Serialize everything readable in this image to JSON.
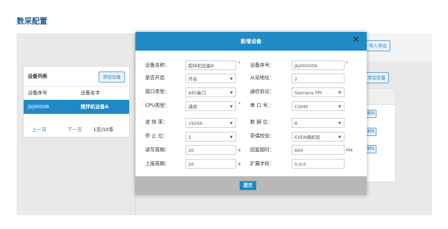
{
  "page": {
    "title": "数采配置"
  },
  "toolbar": {
    "export_label": "导入导出",
    "add_var_label": "添加变量"
  },
  "device_list": {
    "title": "设备列表",
    "add_label": "添加设备",
    "columns": [
      "设备序号",
      "设备名字"
    ],
    "rows": [
      {
        "id": "jbj00008",
        "name": "搅拌机设备A"
      }
    ],
    "pager": {
      "prev": "上一页",
      "next": "下一页",
      "info": "1页/10条"
    }
  },
  "right_table": {
    "delete_label": "删除"
  },
  "modal": {
    "title": "新增设备",
    "close_icon": "close-icon",
    "fields": {
      "device_name": {
        "label": "设备名称：",
        "value": "搅拌机设备B"
      },
      "device_no": {
        "label": "设备序号：",
        "value": "jbj000009"
      },
      "enabled": {
        "label": "是否开启",
        "value": "开启"
      },
      "slave_addr": {
        "label": "从站地址：",
        "value": "2"
      },
      "iface": {
        "label": "接口类型：",
        "value": "485串口"
      },
      "protocol": {
        "label": "通信协议：",
        "value": "Siemens PPI"
      },
      "cpu": {
        "label": "CPU类型：",
        "value": "通用"
      },
      "port": {
        "label": "串 口 号：",
        "value": "COM0"
      },
      "baud": {
        "label": "波 特 率：",
        "value": "19200"
      },
      "databits": {
        "label": "数 据 位：",
        "value": "8"
      },
      "stopbits": {
        "label": "停 止 位：",
        "value": "1"
      },
      "parity": {
        "label": "奇偶校验：",
        "value": "EVEN偶校验"
      },
      "rw_period": {
        "label": "读写周期：",
        "value": "20",
        "unit": "s"
      },
      "timeout": {
        "label": "回复超时：",
        "value": "600",
        "unit": "ms"
      },
      "report_period": {
        "label": "上报周期：",
        "value": "20",
        "unit": "s"
      },
      "ext_field": {
        "label": "扩展字段：",
        "value": "0;0;0"
      }
    },
    "required_mark": "*",
    "submit_label": "提交"
  },
  "colors": {
    "accent": "#1f8ac5",
    "title": "#2a5d8f",
    "required": "#ee3333"
  }
}
